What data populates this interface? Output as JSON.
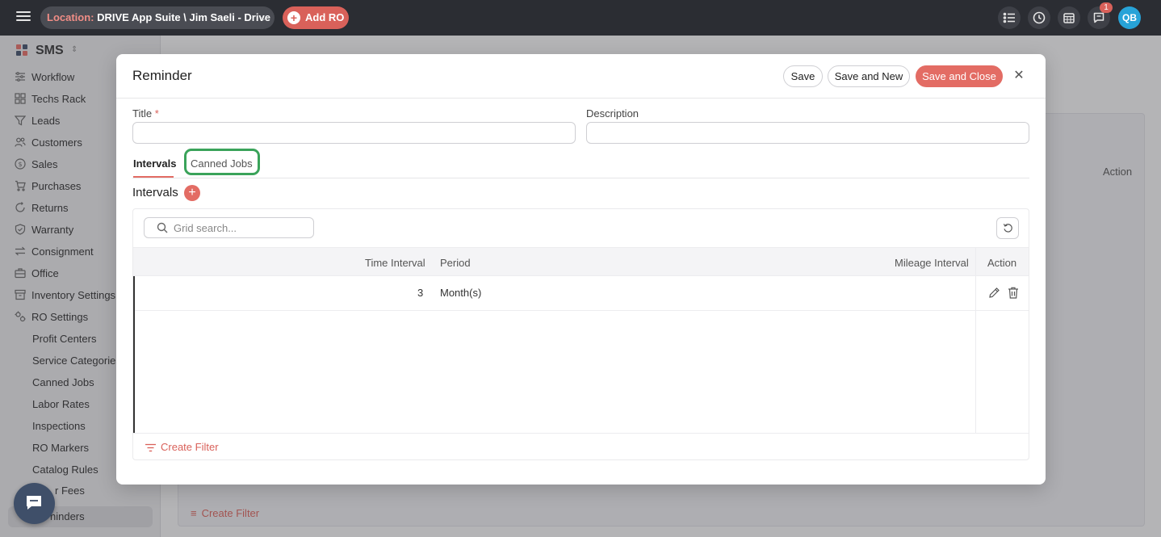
{
  "topbar": {
    "location_label": "Location:",
    "location_value": "DRIVE App Suite \\ Jim Saeli - Drive",
    "add_ro_label": "Add RO",
    "notification_count": "1",
    "avatar_initials": "QB"
  },
  "sidebar": {
    "brand": "SMS",
    "items": [
      {
        "label": "Workflow",
        "icon": "workflow-icon"
      },
      {
        "label": "Techs Rack",
        "icon": "rack-icon"
      },
      {
        "label": "Leads",
        "icon": "funnel-icon"
      },
      {
        "label": "Customers",
        "icon": "users-icon"
      },
      {
        "label": "Sales",
        "icon": "dollar-icon"
      },
      {
        "label": "Purchases",
        "icon": "cart-icon"
      },
      {
        "label": "Returns",
        "icon": "return-icon"
      },
      {
        "label": "Warranty",
        "icon": "shield-icon"
      },
      {
        "label": "Consignment",
        "icon": "swap-icon"
      },
      {
        "label": "Office",
        "icon": "briefcase-icon"
      },
      {
        "label": "Inventory Settings",
        "icon": "inventory-icon"
      },
      {
        "label": "RO Settings",
        "icon": "gears-icon"
      }
    ],
    "sub_items": [
      "Profit Centers",
      "Service Categories",
      "Canned Jobs",
      "Labor Rates",
      "Inspections",
      "RO Markers",
      "Catalog Rules",
      "r Fees",
      "ninders"
    ]
  },
  "background": {
    "action_header": "Action",
    "create_filter": "Create Filter"
  },
  "modal": {
    "title": "Reminder",
    "buttons": {
      "save": "Save",
      "save_new": "Save and New",
      "save_close": "Save and Close"
    },
    "fields": {
      "title_label": "Title",
      "title_required": "*",
      "title_value": "",
      "description_label": "Description",
      "description_value": ""
    },
    "tabs": [
      "Intervals",
      "Canned Jobs"
    ],
    "active_tab": "Intervals",
    "section_title": "Intervals",
    "grid": {
      "search_placeholder": "Grid search...",
      "columns": [
        "Time Interval",
        "Period",
        "Mileage Interval",
        "Action"
      ],
      "rows": [
        {
          "time_interval": "3",
          "period": "Month(s)",
          "mileage_interval": ""
        }
      ],
      "create_filter": "Create Filter"
    }
  },
  "colors": {
    "accent": "#e36c64",
    "topbar": "#2b2d33",
    "highlight": "#3aa35a",
    "avatar": "#27a3d8"
  }
}
